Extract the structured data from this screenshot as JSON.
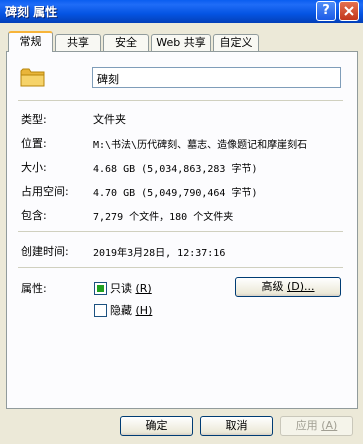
{
  "window": {
    "title": "碑刻 属性",
    "help_label": "?"
  },
  "tabs": [
    {
      "label": "常规",
      "active": true
    },
    {
      "label": "共享"
    },
    {
      "label": "安全"
    },
    {
      "label": "Web 共享"
    },
    {
      "label": "自定义"
    }
  ],
  "folder": {
    "icon": "folder-icon",
    "name": "碑刻"
  },
  "info": {
    "type_label": "类型:",
    "type_value": "文件夹",
    "location_label": "位置:",
    "location_value": "M:\\书法\\历代碑刻、墓志、造像题记和摩崖刻石",
    "size_label": "大小:",
    "size_value": "4.68 GB (5,034,863,283 字节)",
    "disk_label": "占用空间:",
    "disk_value": "4.70 GB (5,049,790,464 字节)",
    "contains_label": "包含:",
    "contains_value": "7,279 个文件，180 个文件夹",
    "created_label": "创建时间:",
    "created_value": "2019年3月28日, 12:37:16"
  },
  "attributes": {
    "label": "属性:",
    "readonly_text": "只读",
    "readonly_key": "(R)",
    "readonly_checked": true,
    "hidden_text": "隐藏",
    "hidden_key": "(H)",
    "hidden_checked": false,
    "advanced_text": "高级",
    "advanced_key": "(D)..."
  },
  "footer": {
    "ok": "确定",
    "cancel": "取消",
    "apply_text": "应用",
    "apply_key": "(A)"
  },
  "colors": {
    "titlebar": "#0454e3",
    "dialog_bg": "#ece9d8",
    "active_tab_accent": "#f7b43a",
    "checkbox_fill": "#21a121"
  }
}
